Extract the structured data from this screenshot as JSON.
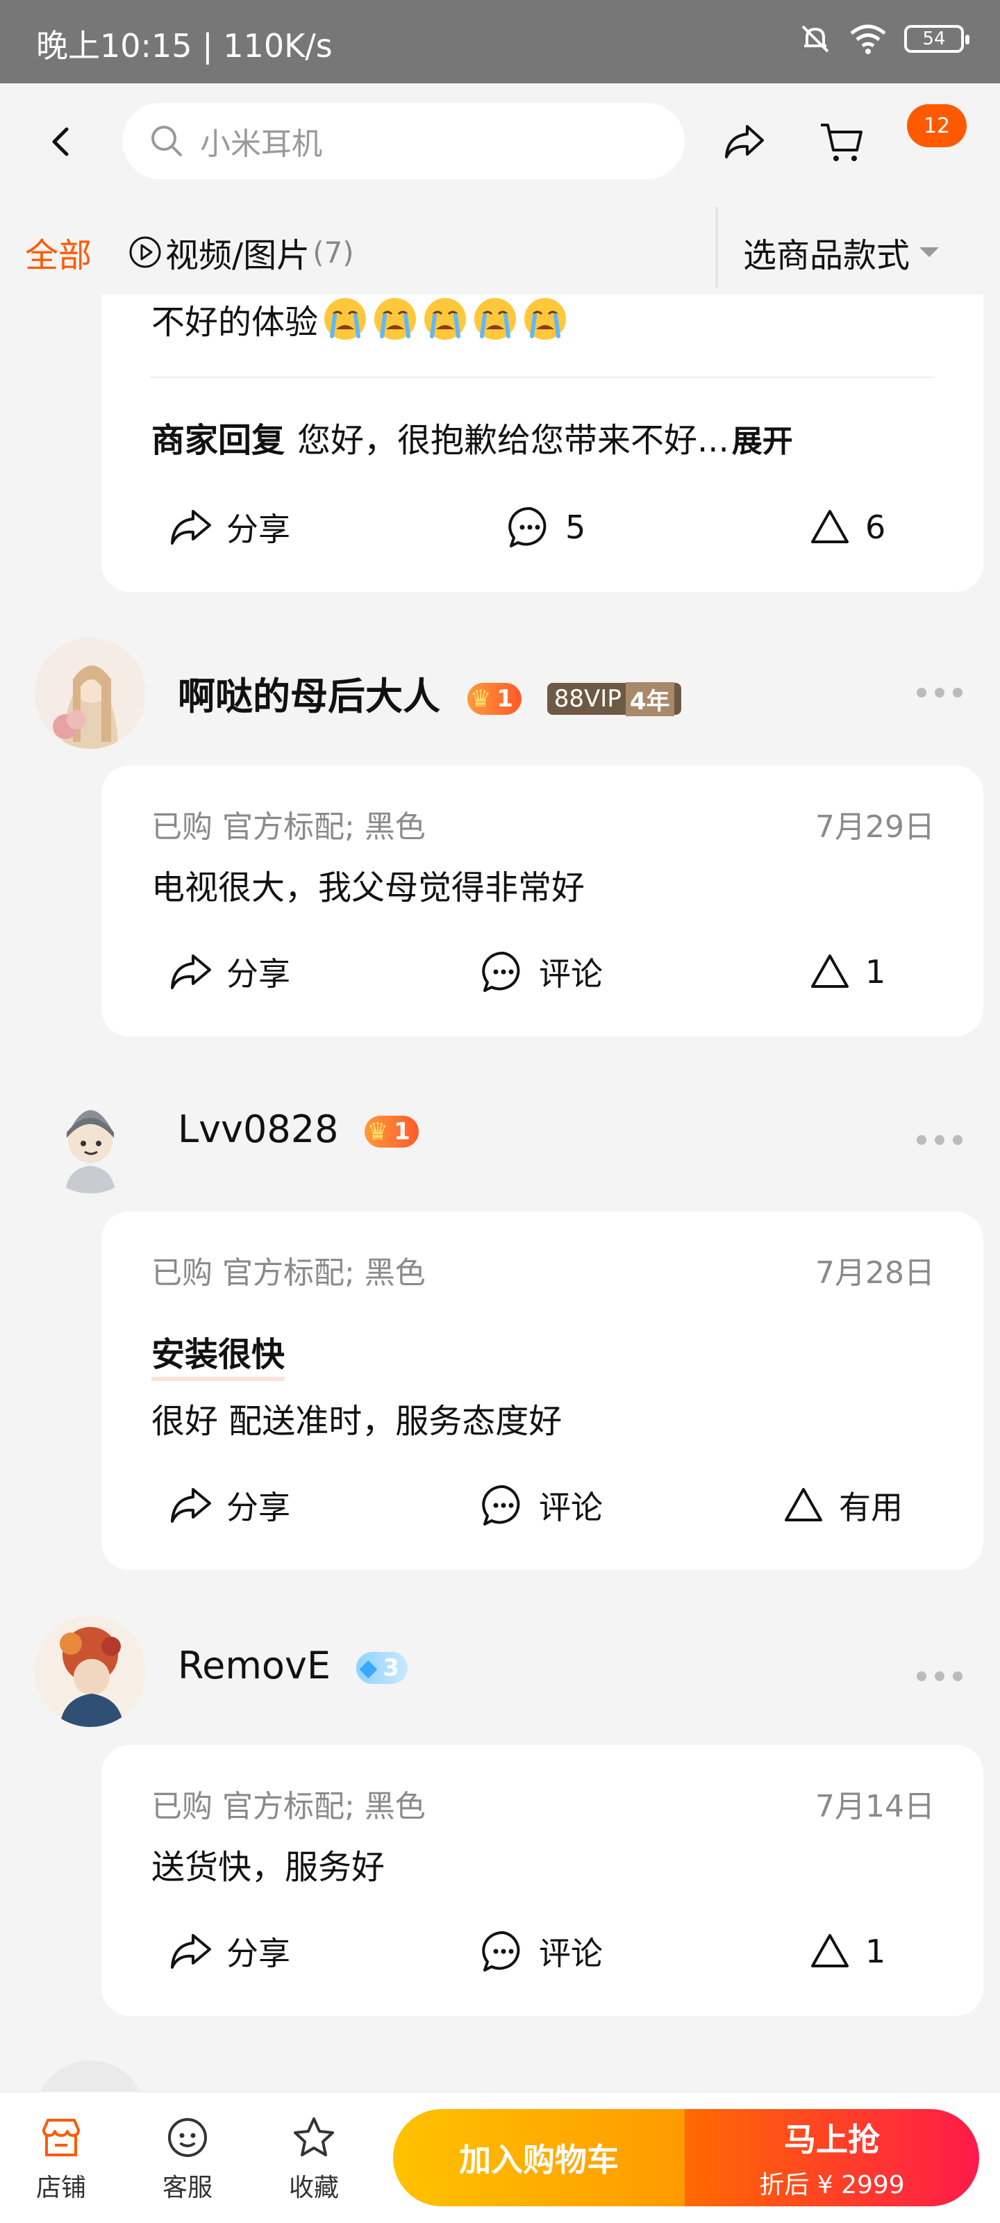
{
  "status": {
    "time": "晚上10:15 | 110K/s",
    "battery": "54"
  },
  "header": {
    "search_placeholder": "小米耳机",
    "cart_badge": "12"
  },
  "filter": {
    "all": "全部",
    "video": "视频/图片",
    "video_count": "(7)",
    "select": "选商品款式"
  },
  "review0": {
    "tail_text": "不好的体验",
    "emoji_count": 5,
    "reply_label": "商家回复",
    "reply_text": "您好，很抱歉给您带来不好...",
    "expand": "展开",
    "share": "分享",
    "comments": "5",
    "useful": "6"
  },
  "reviews": [
    {
      "name": "啊哒的母后大人",
      "level": "1",
      "vip": "88VIP",
      "vip_years": "4年",
      "meta": "已购 官方标配; 黑色",
      "date": "7月29日",
      "text": "电视很大，我父母觉得非常好",
      "share": "分享",
      "comment": "评论",
      "useful": "1"
    },
    {
      "name": "Lvv0828",
      "level": "1",
      "meta": "已购 官方标配; 黑色",
      "date": "7月28日",
      "tag": "安装很快",
      "text": "很好 配送准时，服务态度好",
      "share": "分享",
      "comment": "评论",
      "useful": "有用"
    },
    {
      "name": "RemovE",
      "level": "3",
      "meta": "已购 官方标配; 黑色",
      "date": "7月14日",
      "text": "送货快，服务好",
      "share": "分享",
      "comment": "评论",
      "useful": "1"
    }
  ],
  "bottom": {
    "store": "店铺",
    "service": "客服",
    "favorite": "收藏",
    "add_cart": "加入购物车",
    "buy": "马上抢",
    "price": "折后 ¥ 2999"
  },
  "colors": {
    "accent": "#ff5a00",
    "buy_start": "#ff6a00",
    "buy_end": "#ff1a4a",
    "cart_start": "#ffc200"
  }
}
